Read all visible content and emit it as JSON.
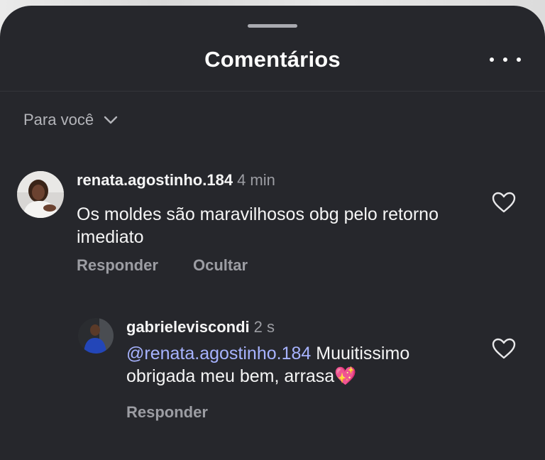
{
  "sheet": {
    "title": "Comentários"
  },
  "filter": {
    "label": "Para você"
  },
  "comments": [
    {
      "username": "renata.agostinho.184",
      "time": "4 min",
      "text": "Os moldes são maravilhosos obg pelo retorno imediato",
      "actions": [
        "Responder",
        "Ocultar"
      ]
    }
  ],
  "reply": {
    "username": "gabrieleviscondi",
    "time": "2 s",
    "mention": "@renata.agostinho.184",
    "text": "Muuitissimo obrigada meu bem, arrasa",
    "emoji": "💖",
    "action": "Responder"
  },
  "colors": {
    "sheet_bg": "#26272c",
    "mention": "#a7b3ff",
    "muted": "#9c9da3"
  },
  "icons": [
    "more-icon",
    "chevron-down-icon",
    "heart-icon",
    "sparkling-heart-icon"
  ]
}
